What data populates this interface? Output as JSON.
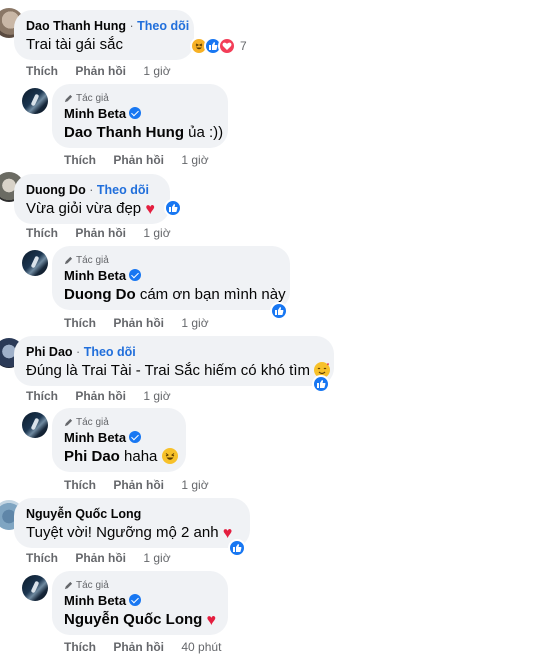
{
  "threads": [
    {
      "comment": {
        "name": "Dao Thanh Hung",
        "follow": "Theo dõi",
        "text": "Trai tài gái sắc",
        "reaction_count": "7"
      },
      "actions": {
        "like": "Thích",
        "reply": "Phản hồi",
        "time": "1 giờ"
      },
      "reply": {
        "author_tag": "Tác giả",
        "name": "Minh Beta",
        "mention": "Dao Thanh Hung",
        "text": " ủa :))"
      },
      "reply_actions": {
        "like": "Thích",
        "reply": "Phản hồi",
        "time": "1 giờ"
      }
    },
    {
      "comment": {
        "name": "Duong Do",
        "follow": "Theo dõi",
        "text": "Vừa giỏi vừa đẹp"
      },
      "actions": {
        "like": "Thích",
        "reply": "Phản hồi",
        "time": "1 giờ"
      },
      "reply": {
        "author_tag": "Tác giả",
        "name": "Minh Beta",
        "mention": "Duong Do",
        "text": " cám ơn bạn mình này"
      },
      "reply_actions": {
        "like": "Thích",
        "reply": "Phản hồi",
        "time": "1 giờ"
      }
    },
    {
      "comment": {
        "name": "Phi Dao",
        "follow": "Theo dõi",
        "text": "Đúng là Trai Tài - Trai Sắc hiếm có khó tìm"
      },
      "actions": {
        "like": "Thích",
        "reply": "Phản hồi",
        "time": "1 giờ"
      },
      "reply": {
        "author_tag": "Tác giả",
        "name": "Minh Beta",
        "mention": "Phi Dao",
        "text": " haha"
      },
      "reply_actions": {
        "like": "Thích",
        "reply": "Phản hồi",
        "time": "1 giờ"
      }
    },
    {
      "comment": {
        "name": "Nguyễn Quốc Long",
        "text": "Tuyệt vời! Ngưỡng mộ 2 anh"
      },
      "actions": {
        "like": "Thích",
        "reply": "Phản hồi",
        "time": "1 giờ"
      },
      "reply": {
        "author_tag": "Tác giả",
        "name": "Minh Beta",
        "mention": "Nguyễn Quốc Long",
        "text": ""
      },
      "reply_actions": {
        "like": "Thích",
        "reply": "Phản hồi",
        "time": "40 phút"
      }
    }
  ],
  "colors": {
    "bubble": "#f0f2f5",
    "follow_link": "#216fdb",
    "meta_text": "#65676b",
    "like_blue": "#1877f2",
    "love_red": "#f33e58",
    "haha_yellow": "#f7b125"
  },
  "icons": [
    "like-reaction-icon",
    "love-reaction-icon",
    "haha-reaction-icon",
    "care-reaction-icon",
    "verified-badge-icon",
    "pen-icon",
    "heart-emoji-icon",
    "laughing-emoji-icon"
  ]
}
